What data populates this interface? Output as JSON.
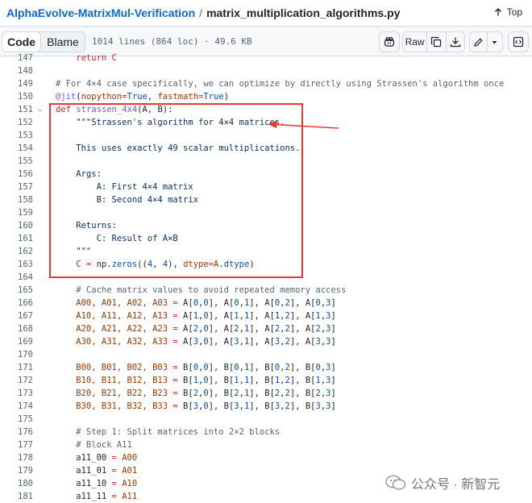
{
  "breadcrumb": {
    "repo": "AlphaEvolve-MatrixMul-Verification",
    "separator": "/",
    "file": "matrix_multiplication_algorithms.py",
    "top_label": "Top",
    "top_icon": "arrow-up-icon"
  },
  "toolbar": {
    "code_tab": "Code",
    "blame_tab": "Blame",
    "meta": "1014 lines (864 loc) · 49.6 KB",
    "raw_label": "Raw",
    "icons": [
      "copilot-icon",
      "copy-icon",
      "download-icon",
      "pencil-icon",
      "chevron-down-icon",
      "symbols-panel-icon"
    ]
  },
  "code_lines": [
    {
      "n": "147",
      "fold": "",
      "tokens": [
        {
          "t": "    return C",
          "c": "kw"
        }
      ]
    },
    {
      "n": "148",
      "fold": "",
      "tokens": []
    },
    {
      "n": "149",
      "fold": "",
      "tokens": [
        {
          "t": "# For 4×4 case specifically, we can optimize by directly using Strassen's algorithm once",
          "c": "cmt"
        }
      ]
    },
    {
      "n": "150",
      "fold": "",
      "tokens": [
        {
          "t": "@jit",
          "c": "fn"
        },
        {
          "t": "(",
          "c": ""
        },
        {
          "t": "nopython",
          "c": "var"
        },
        {
          "t": "=",
          "c": "kw"
        },
        {
          "t": "True",
          "c": "num"
        },
        {
          "t": ", ",
          "c": ""
        },
        {
          "t": "fastmath",
          "c": "var"
        },
        {
          "t": "=",
          "c": "kw"
        },
        {
          "t": "True",
          "c": "num"
        },
        {
          "t": ")",
          "c": ""
        }
      ]
    },
    {
      "n": "151",
      "fold": "⌵",
      "tokens": [
        {
          "t": "def ",
          "c": "kw"
        },
        {
          "t": "strassen_4x4",
          "c": "fn"
        },
        {
          "t": "(A, B):",
          "c": ""
        }
      ]
    },
    {
      "n": "152",
      "fold": "",
      "tokens": [
        {
          "t": "    \"\"\"Strassen's algorithm for 4×4 matrices.",
          "c": "str"
        }
      ]
    },
    {
      "n": "153",
      "fold": "",
      "tokens": []
    },
    {
      "n": "154",
      "fold": "",
      "tokens": [
        {
          "t": "    This uses exactly 49 scalar multiplications.",
          "c": "str"
        }
      ]
    },
    {
      "n": "155",
      "fold": "",
      "tokens": []
    },
    {
      "n": "156",
      "fold": "",
      "tokens": [
        {
          "t": "    Args:",
          "c": "str"
        }
      ]
    },
    {
      "n": "157",
      "fold": "",
      "tokens": [
        {
          "t": "        A: First 4×4 matrix",
          "c": "str"
        }
      ]
    },
    {
      "n": "158",
      "fold": "",
      "tokens": [
        {
          "t": "        B: Second 4×4 matrix",
          "c": "str"
        }
      ]
    },
    {
      "n": "159",
      "fold": "",
      "tokens": []
    },
    {
      "n": "160",
      "fold": "",
      "tokens": [
        {
          "t": "    Returns:",
          "c": "str"
        }
      ]
    },
    {
      "n": "161",
      "fold": "",
      "tokens": [
        {
          "t": "        C: Result of A×B",
          "c": "str"
        }
      ]
    },
    {
      "n": "162",
      "fold": "",
      "tokens": [
        {
          "t": "    \"\"\"",
          "c": "str"
        }
      ]
    },
    {
      "n": "163",
      "fold": "",
      "tokens": [
        {
          "t": "    C ",
          "c": "var"
        },
        {
          "t": "=",
          "c": "kw"
        },
        {
          "t": " np.",
          "c": ""
        },
        {
          "t": "zeros",
          "c": "num"
        },
        {
          "t": "((",
          "c": ""
        },
        {
          "t": "4",
          "c": "num"
        },
        {
          "t": ", ",
          "c": ""
        },
        {
          "t": "4",
          "c": "num"
        },
        {
          "t": "), ",
          "c": ""
        },
        {
          "t": "dtype",
          "c": "var"
        },
        {
          "t": "=",
          "c": "kw"
        },
        {
          "t": "A",
          "c": "var"
        },
        {
          "t": ".",
          "c": ""
        },
        {
          "t": "dtype",
          "c": "num"
        },
        {
          "t": ")",
          "c": ""
        }
      ]
    },
    {
      "n": "164",
      "fold": "",
      "tokens": []
    },
    {
      "n": "165",
      "fold": "",
      "tokens": [
        {
          "t": "    # Cache matrix values to avoid repeated memory access",
          "c": "cmt"
        }
      ]
    },
    {
      "n": "166",
      "fold": "",
      "tokens": [
        {
          "t": "    A00, A01, A02, A03 ",
          "c": "var"
        },
        {
          "t": "=",
          "c": "kw"
        },
        {
          "t": " A[",
          "c": ""
        },
        {
          "t": "0",
          "c": "num"
        },
        {
          "t": ",",
          "c": ""
        },
        {
          "t": "0",
          "c": "num"
        },
        {
          "t": "], A[",
          "c": ""
        },
        {
          "t": "0",
          "c": "num"
        },
        {
          "t": ",",
          "c": ""
        },
        {
          "t": "1",
          "c": "num"
        },
        {
          "t": "], A[",
          "c": ""
        },
        {
          "t": "0",
          "c": "num"
        },
        {
          "t": ",",
          "c": ""
        },
        {
          "t": "2",
          "c": "num"
        },
        {
          "t": "], A[",
          "c": ""
        },
        {
          "t": "0",
          "c": "num"
        },
        {
          "t": ",",
          "c": ""
        },
        {
          "t": "3",
          "c": "num"
        },
        {
          "t": "]",
          "c": ""
        }
      ]
    },
    {
      "n": "167",
      "fold": "",
      "tokens": [
        {
          "t": "    A10, A11, A12, A13 ",
          "c": "var"
        },
        {
          "t": "=",
          "c": "kw"
        },
        {
          "t": " A[",
          "c": ""
        },
        {
          "t": "1",
          "c": "num"
        },
        {
          "t": ",",
          "c": ""
        },
        {
          "t": "0",
          "c": "num"
        },
        {
          "t": "], A[",
          "c": ""
        },
        {
          "t": "1",
          "c": "num"
        },
        {
          "t": ",",
          "c": ""
        },
        {
          "t": "1",
          "c": "num"
        },
        {
          "t": "], A[",
          "c": ""
        },
        {
          "t": "1",
          "c": "num"
        },
        {
          "t": ",",
          "c": ""
        },
        {
          "t": "2",
          "c": "num"
        },
        {
          "t": "], A[",
          "c": ""
        },
        {
          "t": "1",
          "c": "num"
        },
        {
          "t": ",",
          "c": ""
        },
        {
          "t": "3",
          "c": "num"
        },
        {
          "t": "]",
          "c": ""
        }
      ]
    },
    {
      "n": "168",
      "fold": "",
      "tokens": [
        {
          "t": "    A20, A21, A22, A23 ",
          "c": "var"
        },
        {
          "t": "=",
          "c": "kw"
        },
        {
          "t": " A[",
          "c": ""
        },
        {
          "t": "2",
          "c": "num"
        },
        {
          "t": ",",
          "c": ""
        },
        {
          "t": "0",
          "c": "num"
        },
        {
          "t": "], A[",
          "c": ""
        },
        {
          "t": "2",
          "c": "num"
        },
        {
          "t": ",",
          "c": ""
        },
        {
          "t": "1",
          "c": "num"
        },
        {
          "t": "], A[",
          "c": ""
        },
        {
          "t": "2",
          "c": "num"
        },
        {
          "t": ",",
          "c": ""
        },
        {
          "t": "2",
          "c": "num"
        },
        {
          "t": "], A[",
          "c": ""
        },
        {
          "t": "2",
          "c": "num"
        },
        {
          "t": ",",
          "c": ""
        },
        {
          "t": "3",
          "c": "num"
        },
        {
          "t": "]",
          "c": ""
        }
      ]
    },
    {
      "n": "169",
      "fold": "",
      "tokens": [
        {
          "t": "    A30, A31, A32, A33 ",
          "c": "var"
        },
        {
          "t": "=",
          "c": "kw"
        },
        {
          "t": " A[",
          "c": ""
        },
        {
          "t": "3",
          "c": "num"
        },
        {
          "t": ",",
          "c": ""
        },
        {
          "t": "0",
          "c": "num"
        },
        {
          "t": "], A[",
          "c": ""
        },
        {
          "t": "3",
          "c": "num"
        },
        {
          "t": ",",
          "c": ""
        },
        {
          "t": "1",
          "c": "num"
        },
        {
          "t": "], A[",
          "c": ""
        },
        {
          "t": "3",
          "c": "num"
        },
        {
          "t": ",",
          "c": ""
        },
        {
          "t": "2",
          "c": "num"
        },
        {
          "t": "], A[",
          "c": ""
        },
        {
          "t": "3",
          "c": "num"
        },
        {
          "t": ",",
          "c": ""
        },
        {
          "t": "3",
          "c": "num"
        },
        {
          "t": "]",
          "c": ""
        }
      ]
    },
    {
      "n": "170",
      "fold": "",
      "tokens": []
    },
    {
      "n": "171",
      "fold": "",
      "tokens": [
        {
          "t": "    B00, B01, B02, B03 ",
          "c": "var"
        },
        {
          "t": "=",
          "c": "kw"
        },
        {
          "t": " B[",
          "c": ""
        },
        {
          "t": "0",
          "c": "num"
        },
        {
          "t": ",",
          "c": ""
        },
        {
          "t": "0",
          "c": "num"
        },
        {
          "t": "], B[",
          "c": ""
        },
        {
          "t": "0",
          "c": "num"
        },
        {
          "t": ",",
          "c": ""
        },
        {
          "t": "1",
          "c": "num"
        },
        {
          "t": "], B[",
          "c": ""
        },
        {
          "t": "0",
          "c": "num"
        },
        {
          "t": ",",
          "c": ""
        },
        {
          "t": "2",
          "c": "num"
        },
        {
          "t": "], B[",
          "c": ""
        },
        {
          "t": "0",
          "c": "num"
        },
        {
          "t": ",",
          "c": ""
        },
        {
          "t": "3",
          "c": "num"
        },
        {
          "t": "]",
          "c": ""
        }
      ]
    },
    {
      "n": "172",
      "fold": "",
      "tokens": [
        {
          "t": "    B10, B11, B12, B13 ",
          "c": "var"
        },
        {
          "t": "=",
          "c": "kw"
        },
        {
          "t": " B[",
          "c": ""
        },
        {
          "t": "1",
          "c": "num"
        },
        {
          "t": ",",
          "c": ""
        },
        {
          "t": "0",
          "c": "num"
        },
        {
          "t": "], B[",
          "c": ""
        },
        {
          "t": "1",
          "c": "num"
        },
        {
          "t": ",",
          "c": ""
        },
        {
          "t": "1",
          "c": "num"
        },
        {
          "t": "], B[",
          "c": ""
        },
        {
          "t": "1",
          "c": "num"
        },
        {
          "t": ",",
          "c": ""
        },
        {
          "t": "2",
          "c": "num"
        },
        {
          "t": "], B[",
          "c": ""
        },
        {
          "t": "1",
          "c": "num"
        },
        {
          "t": ",",
          "c": ""
        },
        {
          "t": "3",
          "c": "num"
        },
        {
          "t": "]",
          "c": ""
        }
      ]
    },
    {
      "n": "173",
      "fold": "",
      "tokens": [
        {
          "t": "    B20, B21, B22, B23 ",
          "c": "var"
        },
        {
          "t": "=",
          "c": "kw"
        },
        {
          "t": " B[",
          "c": ""
        },
        {
          "t": "2",
          "c": "num"
        },
        {
          "t": ",",
          "c": ""
        },
        {
          "t": "0",
          "c": "num"
        },
        {
          "t": "], B[",
          "c": ""
        },
        {
          "t": "2",
          "c": "num"
        },
        {
          "t": ",",
          "c": ""
        },
        {
          "t": "1",
          "c": "num"
        },
        {
          "t": "], B[",
          "c": ""
        },
        {
          "t": "2",
          "c": "num"
        },
        {
          "t": ",",
          "c": ""
        },
        {
          "t": "2",
          "c": "num"
        },
        {
          "t": "], B[",
          "c": ""
        },
        {
          "t": "2",
          "c": "num"
        },
        {
          "t": ",",
          "c": ""
        },
        {
          "t": "3",
          "c": "num"
        },
        {
          "t": "]",
          "c": ""
        }
      ]
    },
    {
      "n": "174",
      "fold": "",
      "tokens": [
        {
          "t": "    B30, B31, B32, B33 ",
          "c": "var"
        },
        {
          "t": "=",
          "c": "kw"
        },
        {
          "t": " B[",
          "c": ""
        },
        {
          "t": "3",
          "c": "num"
        },
        {
          "t": ",",
          "c": ""
        },
        {
          "t": "0",
          "c": "num"
        },
        {
          "t": "], B[",
          "c": ""
        },
        {
          "t": "3",
          "c": "num"
        },
        {
          "t": ",",
          "c": ""
        },
        {
          "t": "1",
          "c": "num"
        },
        {
          "t": "], B[",
          "c": ""
        },
        {
          "t": "3",
          "c": "num"
        },
        {
          "t": ",",
          "c": ""
        },
        {
          "t": "2",
          "c": "num"
        },
        {
          "t": "], B[",
          "c": ""
        },
        {
          "t": "3",
          "c": "num"
        },
        {
          "t": ",",
          "c": ""
        },
        {
          "t": "3",
          "c": "num"
        },
        {
          "t": "]",
          "c": ""
        }
      ]
    },
    {
      "n": "175",
      "fold": "",
      "tokens": []
    },
    {
      "n": "176",
      "fold": "",
      "tokens": [
        {
          "t": "    # Step 1: Split matrices into 2×2 blocks",
          "c": "cmt"
        }
      ]
    },
    {
      "n": "177",
      "fold": "",
      "tokens": [
        {
          "t": "    # Block A11",
          "c": "cmt"
        }
      ]
    },
    {
      "n": "178",
      "fold": "",
      "tokens": [
        {
          "t": "    a11_00 ",
          "c": ""
        },
        {
          "t": "=",
          "c": "kw"
        },
        {
          "t": " A00",
          "c": "var"
        }
      ]
    },
    {
      "n": "179",
      "fold": "",
      "tokens": [
        {
          "t": "    a11_01 ",
          "c": ""
        },
        {
          "t": "=",
          "c": "kw"
        },
        {
          "t": " A01",
          "c": "var"
        }
      ]
    },
    {
      "n": "180",
      "fold": "",
      "tokens": [
        {
          "t": "    a11_10 ",
          "c": ""
        },
        {
          "t": "=",
          "c": "kw"
        },
        {
          "t": " A10",
          "c": "var"
        }
      ]
    },
    {
      "n": "181",
      "fold": "",
      "tokens": [
        {
          "t": "    a11_11 ",
          "c": ""
        },
        {
          "t": "=",
          "c": "kw"
        },
        {
          "t": " A11",
          "c": "var"
        }
      ]
    }
  ],
  "colors": {
    "keyword": "#cf222e",
    "function": "#8250df",
    "string": "#0a3069",
    "comment": "#59636e",
    "constant": "#0550ae",
    "variable": "#953800",
    "annotation": "#e53935",
    "link": "#0969da"
  },
  "watermark": {
    "text": "公众号 · 新智元",
    "icon": "wechat-icon"
  }
}
